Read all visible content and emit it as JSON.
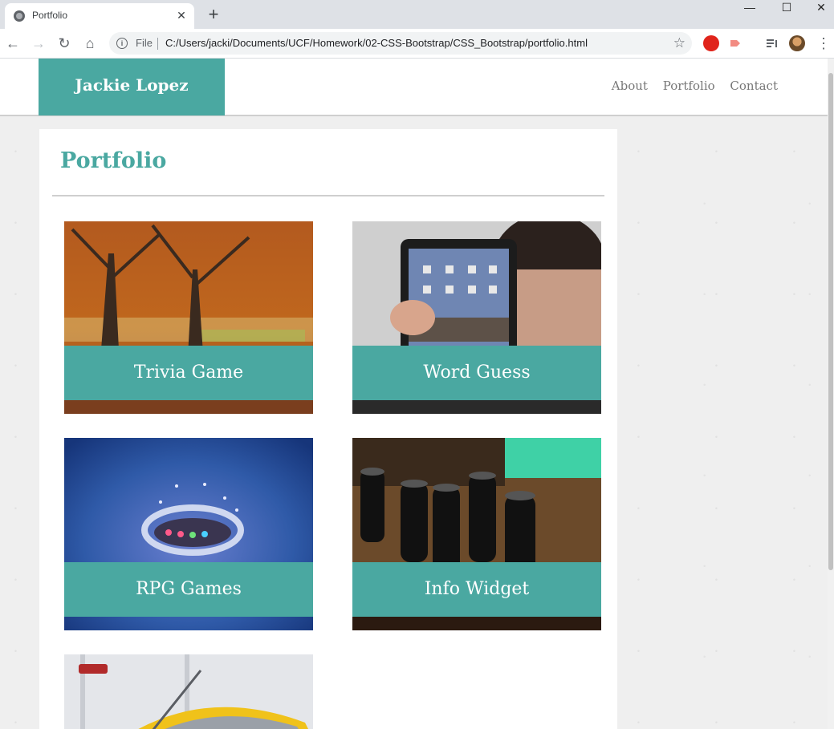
{
  "browser": {
    "tab_title": "Portfolio",
    "new_tab": "+",
    "close_tab": "✕",
    "scheme_label": "File",
    "url": "C:/Users/jacki/Documents/UCF/Homework/02-CSS-Bootstrap/CSS_Bootstrap/portfolio.html",
    "window_controls": {
      "minimize": "—",
      "maximize": "☐",
      "close": "✕"
    }
  },
  "site": {
    "brand": "Jackie Lopez",
    "nav": [
      "About",
      "Portfolio",
      "Contact"
    ]
  },
  "main": {
    "heading": "Portfolio",
    "projects": [
      {
        "title": "Trivia Game",
        "image": "autumn-trees-photo"
      },
      {
        "title": "Word Guess",
        "image": "man-holding-tablet-photo"
      },
      {
        "title": "RPG Games",
        "image": "water-splash-photo"
      },
      {
        "title": "Info Widget",
        "image": "capacitors-circuit-board-photo"
      },
      {
        "title": "",
        "image": "yellow-kayak-photo"
      }
    ]
  },
  "colors": {
    "accent": "#4aa8a1",
    "header_bg": "#ffffff",
    "page_bg": "#efefef"
  }
}
